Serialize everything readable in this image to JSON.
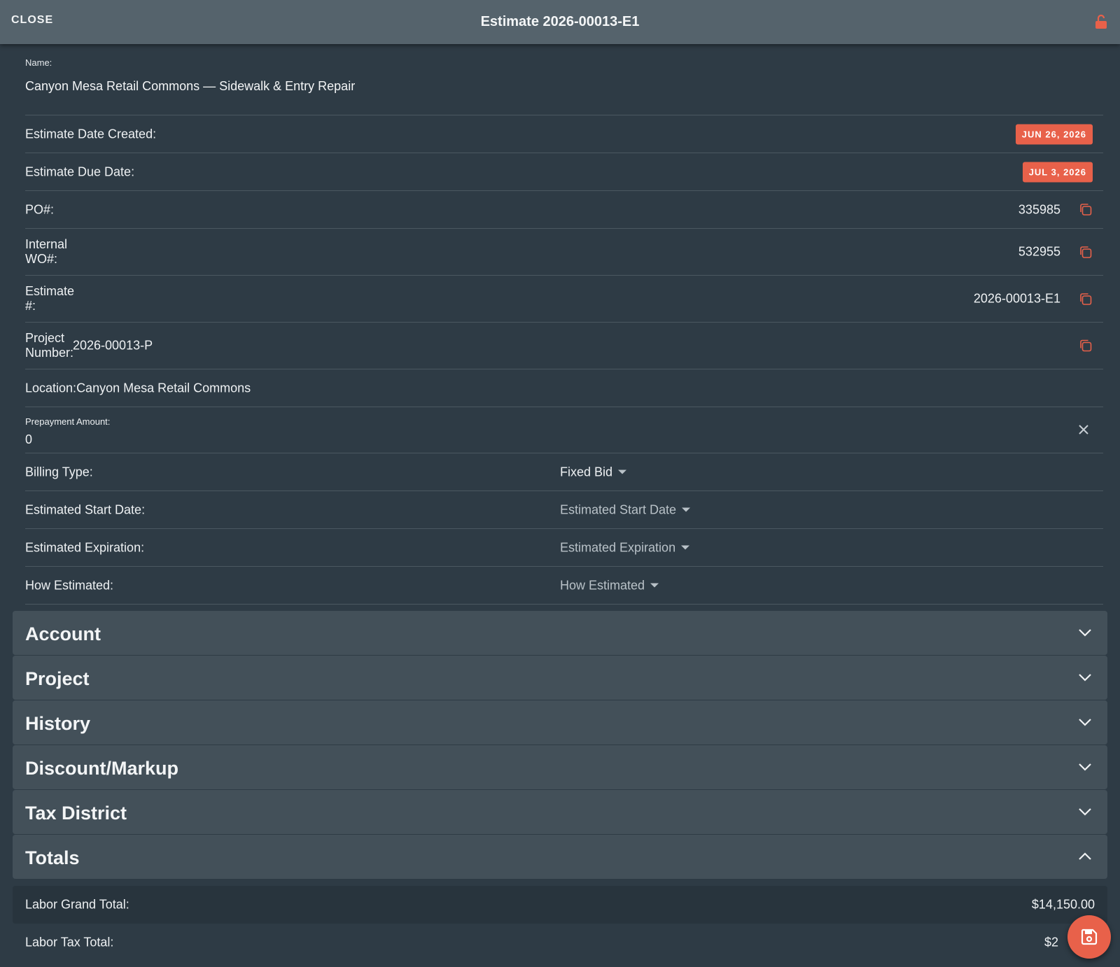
{
  "header": {
    "close_label": "CLOSE",
    "title": "Estimate 2026-00013-E1",
    "lock_icon": "lock-open-icon"
  },
  "name": {
    "label": "Name:",
    "value": "Canyon Mesa Retail Commons — Sidewalk & Entry Repair"
  },
  "fields": {
    "date_created": {
      "label": "Estimate Date Created:",
      "value": "JUN 26, 2026"
    },
    "due_date": {
      "label": "Estimate Due Date:",
      "value": "JUL 3, 2026"
    },
    "po": {
      "label": "PO#:",
      "value": "335985"
    },
    "internal_wo": {
      "label": "Internal WO#:",
      "value": "532955"
    },
    "estimate_no": {
      "label": "Estimate #:",
      "value": "2026-00013-E1"
    },
    "project_number": {
      "label": "Project Number:",
      "value": "2026-00013-P"
    },
    "location": {
      "label": "Location:",
      "value": "Canyon Mesa Retail Commons"
    },
    "prepayment": {
      "label": "Prepayment Amount:",
      "value": "0"
    },
    "billing_type": {
      "label": "Billing Type:",
      "value": "Fixed Bid"
    },
    "est_start": {
      "label": "Estimated Start Date:",
      "placeholder": "Estimated Start Date"
    },
    "est_expiration": {
      "label": "Estimated Expiration:",
      "placeholder": "Estimated Expiration"
    },
    "how_estimated": {
      "label": "How Estimated:",
      "placeholder": "How Estimated"
    }
  },
  "panels": {
    "account": "Account",
    "project": "Project",
    "history": "History",
    "discount": "Discount/Markup",
    "tax_district": "Tax District",
    "totals": "Totals"
  },
  "totals": {
    "labor_grand": {
      "label": "Labor Grand Total:",
      "value": "$14,150.00"
    },
    "labor_tax": {
      "label": "Labor Tax Total:",
      "value": "$2"
    }
  },
  "colors": {
    "accent": "#e8614a",
    "background": "#2e3b45",
    "header": "#55636c",
    "panel": "#435059"
  },
  "fab": {
    "icon": "save-icon"
  }
}
